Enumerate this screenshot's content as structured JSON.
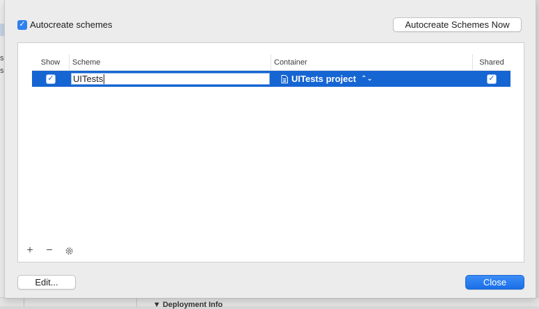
{
  "background": {
    "left_fragments": [
      "s",
      "s"
    ],
    "bottom_label": "Deployment Info"
  },
  "sheet": {
    "autocreate_label": "Autocreate schemes",
    "autocreate_checked": true,
    "autocreate_now_label": "Autocreate Schemes Now",
    "table": {
      "columns": [
        "Show",
        "Scheme",
        "Container",
        "Shared"
      ],
      "rows": [
        {
          "show": true,
          "scheme": "UITests",
          "container": "UITests project",
          "shared": true,
          "selected": true
        }
      ]
    },
    "edit_label": "Edit...",
    "close_label": "Close",
    "colors": {
      "accent": "#1565d3",
      "button_blue": "#2f80ed"
    }
  },
  "icons": [
    "plus-icon",
    "minus-icon",
    "gear-icon",
    "document-icon",
    "up-down-arrows-icon",
    "checkmark-icon"
  ]
}
